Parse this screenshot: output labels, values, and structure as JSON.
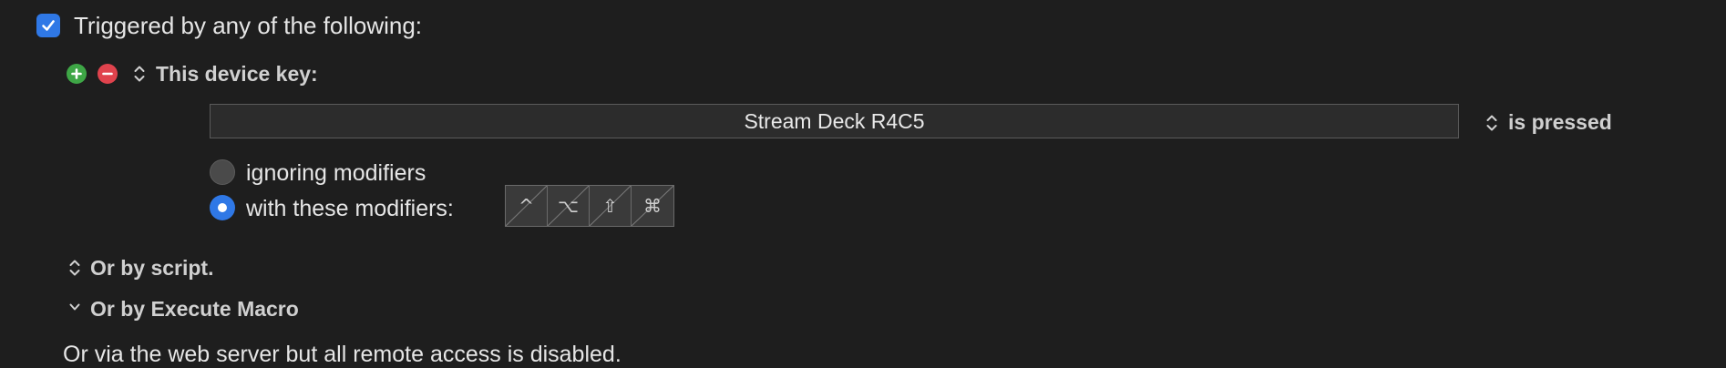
{
  "trigger": {
    "checked": true,
    "label": "Triggered by any of the following:"
  },
  "device_trigger": {
    "add_icon": "plus-circle-icon",
    "remove_icon": "minus-circle-icon",
    "label": "This device key:",
    "key_value": "Stream Deck R4C5",
    "action_label": "is pressed"
  },
  "modifiers": {
    "ignoring_label": "ignoring modifiers",
    "with_label": "with these modifiers:",
    "selected": "with",
    "keys": [
      {
        "name": "control",
        "glyph": "^"
      },
      {
        "name": "option",
        "glyph": "⌥"
      },
      {
        "name": "shift",
        "glyph": "⇧"
      },
      {
        "name": "command",
        "glyph": "⌘"
      }
    ]
  },
  "script_trigger": {
    "label": "Or by script."
  },
  "execute_macro": {
    "label": "Or by Execute Macro"
  },
  "web_server": {
    "label": "Or via the web server but all remote access is disabled."
  },
  "colors": {
    "background": "#1e1e1e",
    "accent": "#2f78e6",
    "add": "#3ea646",
    "remove": "#e0434d"
  }
}
